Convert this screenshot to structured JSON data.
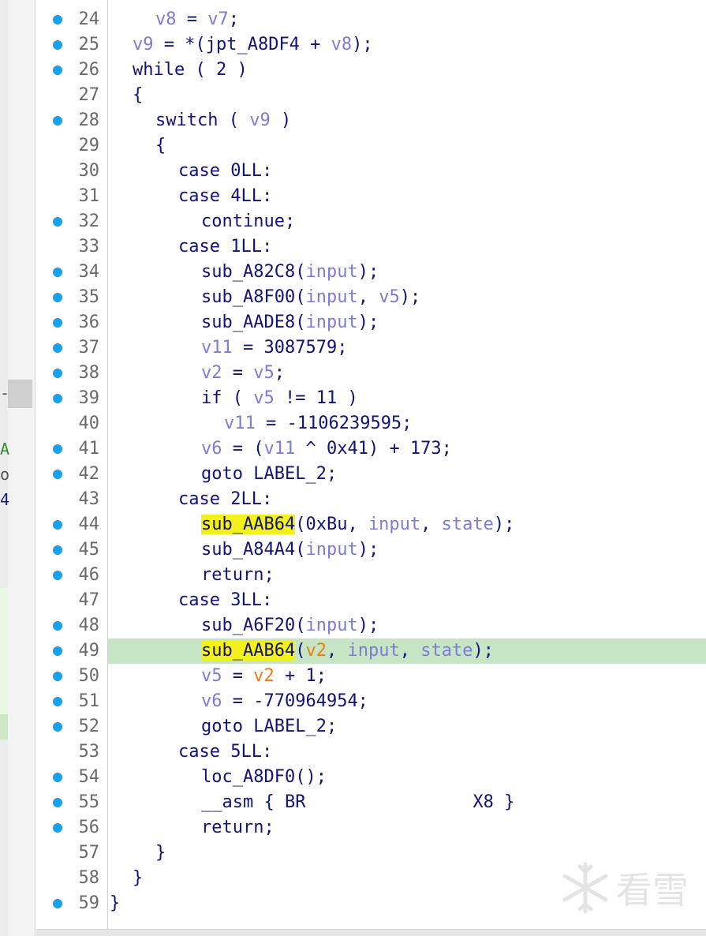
{
  "left_panel": {
    "fragments": [
      {
        "text": "-",
        "color": "#555555"
      },
      {
        "text": "A",
        "color": "#2e8b2e"
      },
      {
        "text": "o",
        "color": "#555555"
      },
      {
        "text": "4",
        "color": "#1a1a80"
      }
    ]
  },
  "watermark": {
    "text": "看雪",
    "icon": "snowflake-logo-icon"
  },
  "colors": {
    "keyword": "#12127a",
    "variable": "#7c7cd6",
    "register_var": "#ef7b12",
    "line_number": "#6a6a6a",
    "breakpoint": "#1ba0ea",
    "highlight_line": "#c5e5c4",
    "highlight_symbol": "#f2f21a"
  },
  "lines": [
    {
      "n": "24",
      "bp": true,
      "indent": 2,
      "tokens": [
        {
          "t": "v8",
          "c": "var"
        },
        {
          "t": " = ",
          "c": "kw"
        },
        {
          "t": "v7",
          "c": "var"
        },
        {
          "t": ";",
          "c": "kw"
        }
      ]
    },
    {
      "n": "25",
      "bp": true,
      "indent": 1,
      "tokens": [
        {
          "t": "v9",
          "c": "var"
        },
        {
          "t": " = *(jpt_A8DF4 + ",
          "c": "kw"
        },
        {
          "t": "v8",
          "c": "var"
        },
        {
          "t": ");",
          "c": "kw"
        }
      ]
    },
    {
      "n": "26",
      "bp": true,
      "indent": 1,
      "tokens": [
        {
          "t": "while ( 2 )",
          "c": "kw"
        }
      ]
    },
    {
      "n": "27",
      "bp": false,
      "indent": 1,
      "tokens": [
        {
          "t": "{",
          "c": "kw"
        }
      ]
    },
    {
      "n": "28",
      "bp": true,
      "indent": 2,
      "tokens": [
        {
          "t": "switch ( ",
          "c": "kw"
        },
        {
          "t": "v9",
          "c": "var"
        },
        {
          "t": " )",
          "c": "kw"
        }
      ]
    },
    {
      "n": "29",
      "bp": false,
      "indent": 2,
      "tokens": [
        {
          "t": "{",
          "c": "kw"
        }
      ]
    },
    {
      "n": "30",
      "bp": false,
      "indent": 3,
      "tokens": [
        {
          "t": "case 0LL:",
          "c": "kw"
        }
      ]
    },
    {
      "n": "31",
      "bp": false,
      "indent": 3,
      "tokens": [
        {
          "t": "case 4LL:",
          "c": "kw"
        }
      ]
    },
    {
      "n": "32",
      "bp": true,
      "indent": 4,
      "tokens": [
        {
          "t": "continue;",
          "c": "kw"
        }
      ]
    },
    {
      "n": "33",
      "bp": false,
      "indent": 3,
      "tokens": [
        {
          "t": "case 1LL:",
          "c": "kw"
        }
      ]
    },
    {
      "n": "34",
      "bp": true,
      "indent": 4,
      "tokens": [
        {
          "t": "sub_A82C8",
          "c": "kw"
        },
        {
          "t": "(",
          "c": "kw"
        },
        {
          "t": "input",
          "c": "var"
        },
        {
          "t": ");",
          "c": "kw"
        }
      ]
    },
    {
      "n": "35",
      "bp": true,
      "indent": 4,
      "tokens": [
        {
          "t": "sub_A8F00",
          "c": "kw"
        },
        {
          "t": "(",
          "c": "kw"
        },
        {
          "t": "input",
          "c": "var"
        },
        {
          "t": ", ",
          "c": "kw"
        },
        {
          "t": "v5",
          "c": "var"
        },
        {
          "t": ");",
          "c": "kw"
        }
      ]
    },
    {
      "n": "36",
      "bp": true,
      "indent": 4,
      "tokens": [
        {
          "t": "sub_AADE8",
          "c": "kw"
        },
        {
          "t": "(",
          "c": "kw"
        },
        {
          "t": "input",
          "c": "var"
        },
        {
          "t": ");",
          "c": "kw"
        }
      ]
    },
    {
      "n": "37",
      "bp": true,
      "indent": 4,
      "tokens": [
        {
          "t": "v11",
          "c": "var"
        },
        {
          "t": " = 3087579;",
          "c": "kw"
        }
      ]
    },
    {
      "n": "38",
      "bp": true,
      "indent": 4,
      "tokens": [
        {
          "t": "v2",
          "c": "var"
        },
        {
          "t": " = ",
          "c": "kw"
        },
        {
          "t": "v5",
          "c": "var"
        },
        {
          "t": ";",
          "c": "kw"
        }
      ]
    },
    {
      "n": "39",
      "bp": true,
      "indent": 4,
      "tokens": [
        {
          "t": "if ( ",
          "c": "kw"
        },
        {
          "t": "v5",
          "c": "var"
        },
        {
          "t": " != 11 )",
          "c": "kw"
        }
      ]
    },
    {
      "n": "40",
      "bp": false,
      "indent": 5,
      "tokens": [
        {
          "t": "v11",
          "c": "var"
        },
        {
          "t": " = -1106239595;",
          "c": "kw"
        }
      ]
    },
    {
      "n": "41",
      "bp": true,
      "indent": 4,
      "tokens": [
        {
          "t": "v6",
          "c": "var"
        },
        {
          "t": " = (",
          "c": "kw"
        },
        {
          "t": "v11",
          "c": "var"
        },
        {
          "t": " ^ 0x41) + 173;",
          "c": "kw"
        }
      ]
    },
    {
      "n": "42",
      "bp": true,
      "indent": 4,
      "tokens": [
        {
          "t": "goto LABEL_2;",
          "c": "kw"
        }
      ]
    },
    {
      "n": "43",
      "bp": false,
      "indent": 3,
      "tokens": [
        {
          "t": "case 2LL:",
          "c": "kw"
        }
      ]
    },
    {
      "n": "44",
      "bp": true,
      "indent": 4,
      "tokens": [
        {
          "t": "sub_AAB64",
          "c": "hl"
        },
        {
          "t": "(0xBu, ",
          "c": "kw"
        },
        {
          "t": "input",
          "c": "var"
        },
        {
          "t": ", ",
          "c": "kw"
        },
        {
          "t": "state",
          "c": "var"
        },
        {
          "t": ");",
          "c": "kw"
        }
      ]
    },
    {
      "n": "45",
      "bp": true,
      "indent": 4,
      "tokens": [
        {
          "t": "sub_A84A4",
          "c": "kw"
        },
        {
          "t": "(",
          "c": "kw"
        },
        {
          "t": "input",
          "c": "var"
        },
        {
          "t": ");",
          "c": "kw"
        }
      ]
    },
    {
      "n": "46",
      "bp": true,
      "indent": 4,
      "tokens": [
        {
          "t": "return;",
          "c": "kw"
        }
      ]
    },
    {
      "n": "47",
      "bp": false,
      "indent": 3,
      "tokens": [
        {
          "t": "case 3LL:",
          "c": "kw"
        }
      ]
    },
    {
      "n": "48",
      "bp": true,
      "indent": 4,
      "tokens": [
        {
          "t": "sub_A6F20",
          "c": "kw"
        },
        {
          "t": "(",
          "c": "kw"
        },
        {
          "t": "input",
          "c": "var"
        },
        {
          "t": ");",
          "c": "kw"
        }
      ]
    },
    {
      "n": "49",
      "bp": true,
      "indent": 4,
      "current": true,
      "tokens": [
        {
          "t": "sub_AAB64",
          "c": "hl"
        },
        {
          "t": "(",
          "c": "kw"
        },
        {
          "t": "v2",
          "c": "reg"
        },
        {
          "t": ", ",
          "c": "kw"
        },
        {
          "t": "input",
          "c": "var"
        },
        {
          "t": ", ",
          "c": "kw"
        },
        {
          "t": "state",
          "c": "var"
        },
        {
          "t": ");",
          "c": "kw"
        }
      ]
    },
    {
      "n": "50",
      "bp": true,
      "indent": 4,
      "tokens": [
        {
          "t": "v5",
          "c": "var"
        },
        {
          "t": " = ",
          "c": "kw"
        },
        {
          "t": "v2",
          "c": "reg"
        },
        {
          "t": " + 1;",
          "c": "kw"
        }
      ]
    },
    {
      "n": "51",
      "bp": true,
      "indent": 4,
      "tokens": [
        {
          "t": "v6",
          "c": "var"
        },
        {
          "t": " = -770964954;",
          "c": "kw"
        }
      ]
    },
    {
      "n": "52",
      "bp": true,
      "indent": 4,
      "tokens": [
        {
          "t": "goto LABEL_2;",
          "c": "kw"
        }
      ]
    },
    {
      "n": "53",
      "bp": false,
      "indent": 3,
      "tokens": [
        {
          "t": "case 5LL:",
          "c": "kw"
        }
      ]
    },
    {
      "n": "54",
      "bp": true,
      "indent": 4,
      "tokens": [
        {
          "t": "loc_A8DF0();",
          "c": "kw"
        }
      ]
    },
    {
      "n": "55",
      "bp": true,
      "indent": 4,
      "tokens": [
        {
          "t": "__asm { BR                X8 }",
          "c": "kw"
        }
      ]
    },
    {
      "n": "56",
      "bp": true,
      "indent": 4,
      "tokens": [
        {
          "t": "return;",
          "c": "kw"
        }
      ]
    },
    {
      "n": "57",
      "bp": false,
      "indent": 2,
      "tokens": [
        {
          "t": "}",
          "c": "kw"
        }
      ]
    },
    {
      "n": "58",
      "bp": false,
      "indent": 1,
      "tokens": [
        {
          "t": "}",
          "c": "kw"
        }
      ]
    },
    {
      "n": "59",
      "bp": true,
      "indent": 0,
      "tokens": [
        {
          "t": "}",
          "c": "kw"
        }
      ]
    }
  ]
}
